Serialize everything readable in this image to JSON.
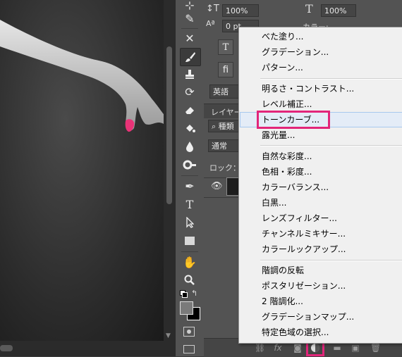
{
  "type_panel": {
    "leading_value": "100%",
    "tracking_value": "100%",
    "baseline_value": "0 pt",
    "color_label": "カラー:",
    "language_value": "英語"
  },
  "layers_panel": {
    "title": "レイヤー",
    "search_placeholder": "種類",
    "blend_mode_value": "通常",
    "lock_label": "ロック："
  },
  "menu": {
    "groups": [
      [
        "べた塗り...",
        "グラデーション...",
        "パターン..."
      ],
      [
        "明るさ・コントラスト...",
        "レベル補正...",
        "トーンカーブ...",
        "露光量..."
      ],
      [
        "自然な彩度...",
        "色相・彩度...",
        "カラーバランス...",
        "白黒...",
        "レンズフィルター...",
        "チャンネルミキサー...",
        "カラールックアップ..."
      ],
      [
        "階調の反転",
        "ポスタリゼーション...",
        "2 階調化...",
        "グラデーションマップ...",
        "特定色域の選択..."
      ]
    ],
    "highlighted": "トーンカーブ..."
  },
  "colors": {
    "highlight": "#e2257a",
    "panel_bg": "#535353",
    "menu_bg": "#f0f0f0"
  },
  "icons": {
    "tools": [
      "eyedropper-icon",
      "healing-brush-icon",
      "brush-icon",
      "clone-stamp-icon",
      "history-brush-icon",
      "eraser-icon",
      "paint-bucket-icon",
      "blur-icon",
      "dodge-icon",
      "pen-icon",
      "type-icon",
      "path-select-icon",
      "rectangle-icon",
      "hand-icon",
      "zoom-icon",
      "swap-colors-icon",
      "quick-mask-icon",
      "screen-mode-icon"
    ],
    "bottom_bar": [
      "link-icon",
      "fx-icon",
      "mask-icon",
      "adjustment-layer-icon",
      "group-folder-icon",
      "new-layer-icon",
      "trash-icon"
    ]
  }
}
